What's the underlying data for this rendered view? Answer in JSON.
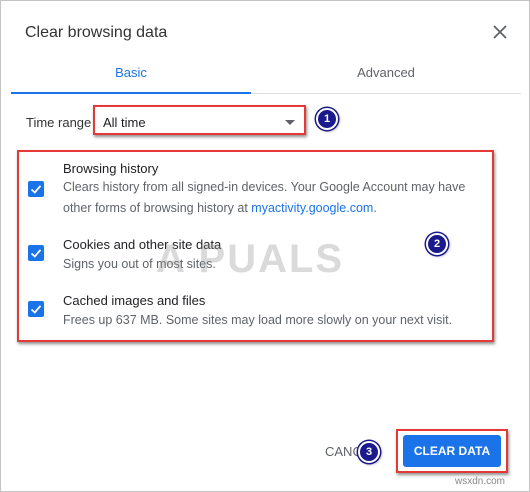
{
  "dialog": {
    "title": "Clear browsing data",
    "close_icon": "close-icon"
  },
  "tabs": [
    {
      "label": "Basic",
      "active": true
    },
    {
      "label": "Advanced",
      "active": false
    }
  ],
  "time_range": {
    "label": "Time range",
    "value": "All time"
  },
  "options": [
    {
      "title": "Browsing history",
      "description_line1": "Clears history from all signed-in devices. Your Google Account may have",
      "description_line2_prefix": "other forms of browsing history at ",
      "link_text": "myactivity.google.com",
      "description_line2_suffix": ".",
      "checked": true
    },
    {
      "title": "Cookies and other site data",
      "description": "Signs you out of most sites.",
      "checked": true
    },
    {
      "title": "Cached images and files",
      "description": "Frees up 637 MB. Some sites may load more slowly on your next visit.",
      "checked": true
    }
  ],
  "buttons": {
    "cancel": "CANC",
    "clear": "CLEAR DATA"
  },
  "annotations": {
    "markers": [
      "1",
      "2",
      "3"
    ],
    "watermark": "A PUALS",
    "footer": "wsxdn.com"
  },
  "colors": {
    "accent": "#1a73e8",
    "highlight": "#e53935",
    "marker": "#1a1a8c"
  }
}
